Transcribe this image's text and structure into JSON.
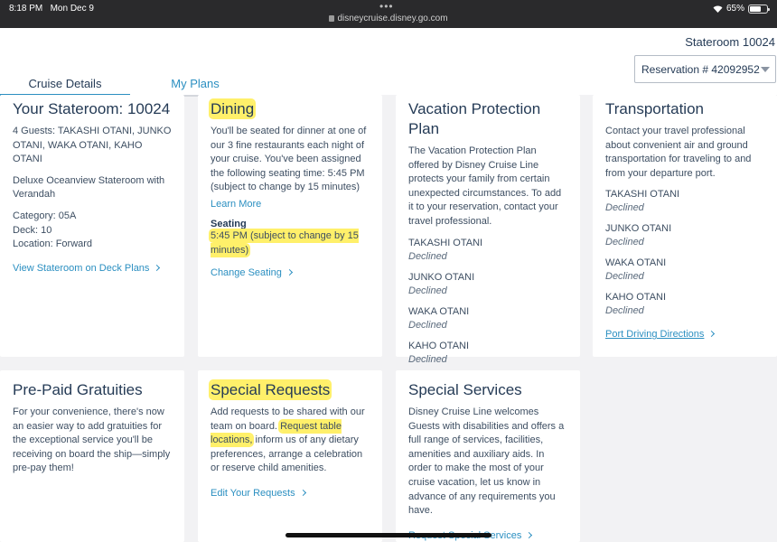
{
  "status": {
    "time": "8:18 PM",
    "date": "Mon Dec 9",
    "url": "disneycruise.disney.go.com",
    "battery": "65%"
  },
  "header": {
    "stateroom": "Stateroom 10024",
    "reservation": "Reservation # 42092952"
  },
  "tabs": {
    "cruise_details": "Cruise Details",
    "my_plans": "My Plans"
  },
  "stateroom": {
    "title": "Your Stateroom: 10024",
    "guests": "4 Guests: TAKASHI OTANI, JUNKO OTANI, WAKA OTANI, KAHO OTANI",
    "room_type": "Deluxe Oceanview Stateroom with Verandah",
    "category": "Category: 05A",
    "deck": "Deck: 10",
    "location": "Location: Forward",
    "link": "View Stateroom on Deck Plans"
  },
  "dining": {
    "title": "Dining",
    "body": "You'll be seated for dinner at one of our 3 fine restaurants each night of your cruise. You've been assigned the following seating time: 5:45 PM (subject to change by 15 minutes)",
    "learn_more": "Learn More",
    "seating_label": "Seating",
    "seating_value": "5:45 PM (subject to change by 15 minutes)",
    "change_link": "Change Seating"
  },
  "vpp": {
    "title": "Vacation Protection Plan",
    "body": "The Vacation Protection Plan offered by Disney Cruise Line protects your family from certain unexpected circumstances. To add it to your reservation, contact your travel professional.",
    "guests": [
      {
        "name": "TAKASHI OTANI",
        "status": "Declined"
      },
      {
        "name": "JUNKO OTANI",
        "status": "Declined"
      },
      {
        "name": "WAKA OTANI",
        "status": "Declined"
      },
      {
        "name": "KAHO OTANI",
        "status": "Declined"
      }
    ]
  },
  "transport": {
    "title": "Transportation",
    "body": "Contact your travel professional about convenient air and ground transportation for traveling to and from your departure port.",
    "guests": [
      {
        "name": "TAKASHI OTANI",
        "status": "Declined"
      },
      {
        "name": "JUNKO OTANI",
        "status": "Declined"
      },
      {
        "name": "WAKA OTANI",
        "status": "Declined"
      },
      {
        "name": "KAHO OTANI",
        "status": "Declined"
      }
    ],
    "link": "Port Driving Directions"
  },
  "gratuities": {
    "title": "Pre-Paid Gratuities",
    "body": "For your convenience, there's now an easier way to add gratuities for the exceptional service you'll be receiving on board the ship—simply pre-pay them!"
  },
  "requests": {
    "title": "Special Requests",
    "body_a": "Add requests to be shared with our team on board. ",
    "body_hl": "Request table locations,",
    "body_b": " inform us of any dietary preferences, arrange a celebration or reserve child amenities.",
    "link": "Edit Your Requests"
  },
  "services": {
    "title": "Special Services",
    "body": "Disney Cruise Line welcomes Guests with disabilities and offers a full range of services, facilities, amenities and auxiliary aids. In order to make the most of your cruise vacation, let us know in advance of any requirements you have.",
    "link": "Request Special Services"
  }
}
